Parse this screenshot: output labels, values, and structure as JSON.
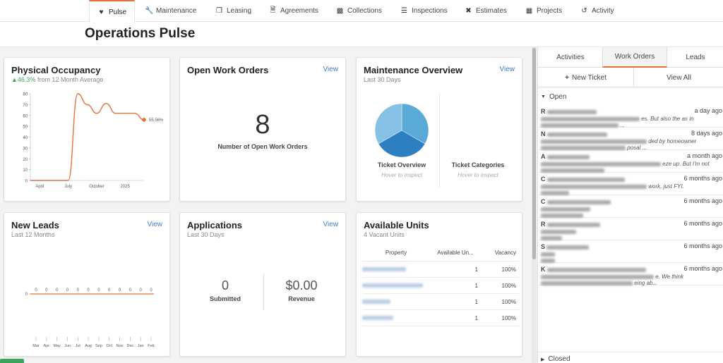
{
  "nav": {
    "tabs": [
      {
        "label": "Pulse",
        "icon": "heart-pulse-icon"
      },
      {
        "label": "Maintenance",
        "icon": "wrench-icon"
      },
      {
        "label": "Leasing",
        "icon": "copy-icon"
      },
      {
        "label": "Agreements",
        "icon": "document-icon"
      },
      {
        "label": "Collections",
        "icon": "clipboard-icon"
      },
      {
        "label": "Inspections",
        "icon": "checklist-icon"
      },
      {
        "label": "Estimates",
        "icon": "tools-icon"
      },
      {
        "label": "Projects",
        "icon": "calendar-icon"
      },
      {
        "label": "Activity",
        "icon": "history-icon"
      }
    ]
  },
  "page": {
    "title": "Operations Pulse"
  },
  "cards": {
    "occupancy": {
      "title": "Physical Occupancy",
      "trend_value": "46.3%",
      "trend_text": "from 12 Month Average",
      "current_label": "55.56%"
    },
    "open_work_orders": {
      "title": "Open Work Orders",
      "view": "View",
      "count": "8",
      "count_label": "Number of Open Work Orders"
    },
    "maintenance": {
      "title": "Maintenance Overview",
      "subtitle": "Last 30 Days",
      "view": "View",
      "ticket_overview": "Ticket Overview",
      "ticket_categories": "Ticket Categories",
      "hover": "Hover to inspect"
    },
    "new_leads": {
      "title": "New Leads",
      "subtitle": "Last 12 Months",
      "view": "View"
    },
    "applications": {
      "title": "Applications",
      "subtitle": "Last 30 Days",
      "view": "View",
      "submitted_value": "0",
      "submitted_label": "Submitted",
      "revenue_value": "$0.00",
      "revenue_label": "Revenue"
    },
    "available_units": {
      "title": "Available Units",
      "subtitle": "4 Vacant Units",
      "columns": [
        "Property",
        "Available Un...",
        "Vacancy"
      ],
      "rows": [
        {
          "available": "1",
          "vacancy": "100%"
        },
        {
          "available": "1",
          "vacancy": "100%"
        },
        {
          "available": "1",
          "vacancy": "100%"
        },
        {
          "available": "1",
          "vacancy": "100%"
        }
      ]
    }
  },
  "chart_data": [
    {
      "type": "line",
      "x": [
        "",
        "April",
        "",
        "",
        "July",
        "",
        "",
        "October",
        "",
        "",
        "2025",
        "",
        ""
      ],
      "x_ticks": [
        "April",
        "July",
        "October",
        "2025"
      ],
      "series": [
        {
          "values": [
            0,
            0,
            0,
            0,
            0,
            80,
            70,
            62,
            71,
            62,
            62,
            62,
            56
          ]
        }
      ],
      "y_ticks": [
        "0",
        "10",
        "20",
        "30",
        "40",
        "50",
        "60",
        "70",
        "80"
      ],
      "ylim": [
        0,
        80
      ],
      "end_label": "55.56%",
      "color": "#e8703a"
    },
    {
      "type": "line",
      "categories": [
        "Mar",
        "Apr",
        "May",
        "Jun",
        "Jul",
        "Aug",
        "Sep",
        "Oct",
        "Nov",
        "Dec",
        "Jan",
        "Feb"
      ],
      "series": [
        {
          "values": [
            0,
            0,
            0,
            0,
            0,
            0,
            0,
            0,
            0,
            0,
            0,
            0
          ]
        }
      ],
      "y_ticks": [
        "0"
      ],
      "color": "#e8703a"
    },
    {
      "type": "pie",
      "values": [
        1,
        1,
        1
      ],
      "colors": [
        "#5aaad8",
        "#2e7fc0",
        "#86c0e4"
      ]
    }
  ],
  "right_panel": {
    "tabs": [
      "Activities",
      "Work Orders",
      "Leads"
    ],
    "new_ticket": "New Ticket",
    "view_all": "View All",
    "open_label": "Open",
    "closed_label": "Closed",
    "tickets": [
      {
        "name": "R",
        "time": "a day ago",
        "line1": "es. But also the as in",
        "line2": "..."
      },
      {
        "name": "N",
        "time": "8 days ago",
        "line1": "ded by homeowner",
        "line2": "posal ..."
      },
      {
        "name": "A",
        "time": "a month ago",
        "line1": "eze up. But I'm not",
        "line2": ""
      },
      {
        "name": "C",
        "time": "6 months ago",
        "line1": "work, just FYI.",
        "line2": ""
      },
      {
        "name": "C",
        "time": "6 months ago",
        "line1": "",
        "line2": ""
      },
      {
        "name": "R",
        "time": "6 months ago",
        "line1": "",
        "line2": ""
      },
      {
        "name": "S",
        "time": "6 months ago",
        "line1": "",
        "line2": ""
      },
      {
        "name": "K",
        "time": "6 months ago",
        "line1": "e. We think",
        "line2": "eing ab..."
      }
    ]
  }
}
